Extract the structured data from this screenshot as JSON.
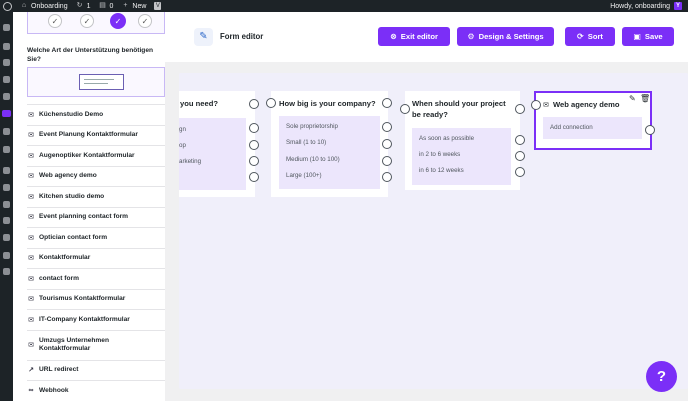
{
  "adminbar": {
    "site_name": "Onboarding",
    "updates_count": "1",
    "comments_count": "0",
    "new_label": "New",
    "howdy": "Howdy, onboarding"
  },
  "sidebar": {
    "question": "Welche Art der Unterstützung benötigen Sie?",
    "forms": [
      {
        "label": "Küchenstudio Demo",
        "icon": "envelope-icon"
      },
      {
        "label": "Event Planung Kontaktformular",
        "icon": "envelope-icon"
      },
      {
        "label": "Augenoptiker Kontaktformular",
        "icon": "envelope-icon"
      },
      {
        "label": "Web agency demo",
        "icon": "envelope-icon"
      },
      {
        "label": "Kitchen studio demo",
        "icon": "envelope-icon"
      },
      {
        "label": "Event planning contact form",
        "icon": "envelope-icon"
      },
      {
        "label": "Optician contact form",
        "icon": "envelope-icon"
      },
      {
        "label": "Kontaktformular",
        "icon": "envelope-icon"
      },
      {
        "label": "contact form",
        "icon": "envelope-icon"
      },
      {
        "label": "Tourismus Kontaktformular",
        "icon": "envelope-icon"
      },
      {
        "label": "IT-Company Kontaktformular",
        "icon": "envelope-icon"
      },
      {
        "label": "Umzugs Unternehmen Kontaktformular",
        "icon": "envelope-icon"
      },
      {
        "label": "URL redirect",
        "icon": "external-link-icon"
      },
      {
        "label": "Webhook",
        "icon": "link-icon"
      }
    ]
  },
  "header": {
    "title": "Form editor",
    "exit_label": "Exit editor",
    "design_label": "Design & Settings",
    "sort_label": "Sort",
    "save_label": "Save"
  },
  "cards": {
    "card1": {
      "question": "you need?",
      "options": [
        "gn",
        "op",
        "arketing",
        ""
      ]
    },
    "card2": {
      "question": "How big is your company?",
      "options": [
        "Sole proprietorship",
        "Small (1 to 10)",
        "Medium (10 to 100)",
        "Large (100+)"
      ]
    },
    "card3": {
      "question": "When should your project be ready?",
      "options": [
        "As soon as possible",
        "in 2 to 6 weeks",
        "in 6 to 12 weeks"
      ]
    },
    "card4": {
      "title": "Web agency demo",
      "add_connection": "Add connection"
    }
  },
  "help": "?",
  "colors": {
    "accent": "#7b2ff7",
    "option_bg": "#ece6fc",
    "canvas_bg": "#f0effa"
  }
}
